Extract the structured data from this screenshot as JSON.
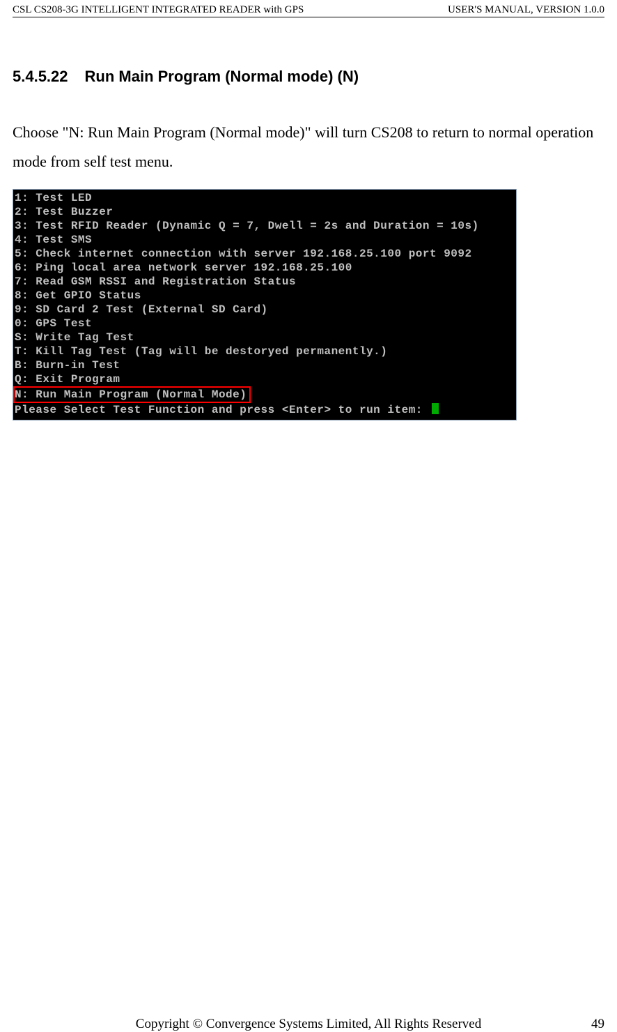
{
  "header": {
    "left": "CSL CS208-3G INTELLIGENT INTEGRATED READER with GPS",
    "right": "USER'S  MANUAL,  VERSION  1.0.0"
  },
  "section": {
    "number": "5.4.5.22",
    "title": "Run Main Program (Normal mode) (N)"
  },
  "body": {
    "paragraph1": "Choose \"N: Run Main Program (Normal mode)\" will turn CS208 to return to normal operation mode from self test menu."
  },
  "terminal": {
    "lines_before": [
      "1: Test LED",
      "2: Test Buzzer",
      "3: Test RFID Reader (Dynamic Q = 7, Dwell = 2s and Duration = 10s)",
      "4: Test SMS",
      "5: Check internet connection with server 192.168.25.100 port 9092",
      "6: Ping local area network server 192.168.25.100",
      "7: Read GSM RSSI and Registration Status",
      "8: Get GPIO Status",
      "9: SD Card 2 Test (External SD Card)",
      "0: GPS Test",
      "S: Write Tag Test",
      "T: Kill Tag Test (Tag will be destoryed permanently.)",
      "",
      "B: Burn-in Test",
      "Q: Exit Program"
    ],
    "highlight_line": "N: Run Main Program (Normal Mode) ",
    "prompt_line": "Please Select Test Function and press <Enter> to run item: "
  },
  "footer": {
    "center": "Copyright © Convergence Systems Limited, All Rights Reserved",
    "page": "49"
  }
}
